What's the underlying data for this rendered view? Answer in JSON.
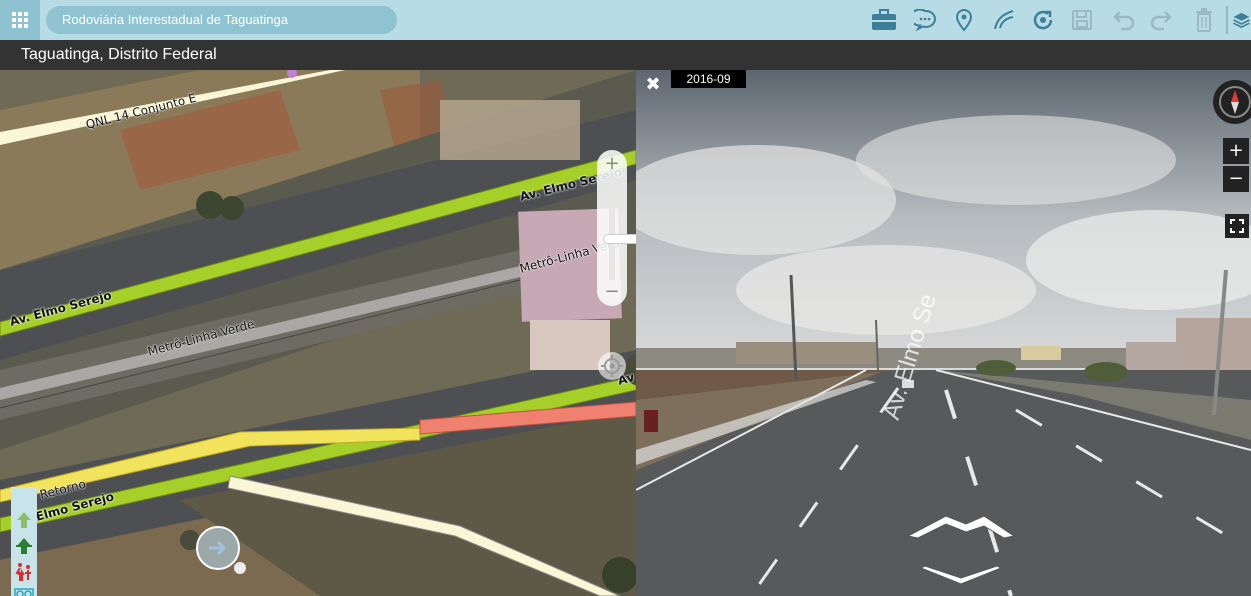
{
  "toolbar": {
    "search_value": "Rodoviária Interestadual de Taguatinga",
    "icons": [
      "apps-grid-icon",
      "briefcase-icon",
      "comment-icon",
      "location-pin-icon",
      "route-icon",
      "refresh-icon",
      "save-icon",
      "undo-icon",
      "redo-icon",
      "delete-icon",
      "layers-icon"
    ]
  },
  "location": {
    "title": "Taguatinga, Distrito Federal"
  },
  "map": {
    "labels": {
      "qnl": "QNL 14 Conjunto E",
      "elmo_top": "Av. Elmo Serejo",
      "elmo_left": "Av. Elmo Serejo",
      "metro_station": "Metrô-Linha Verde",
      "metro_track": "Metrô-Linha Verde",
      "retorno": "Retorno",
      "elmo_bottom": "Elmo Serejo",
      "av_right": "Av"
    },
    "zoom_in": "+",
    "zoom_out": "−"
  },
  "street_view": {
    "date": "2016-09",
    "close": "✖",
    "zoom_in": "+",
    "zoom_out": "−",
    "road_label": "Av. Elmo Se"
  },
  "colors": {
    "toolbar_bg": "#b8dce6",
    "toolbar_icon": "#3d7f97",
    "subbar_bg": "#333333",
    "road_green": "#a6cf2a",
    "road_yellow": "#f2e35d",
    "road_red": "#f08070"
  }
}
